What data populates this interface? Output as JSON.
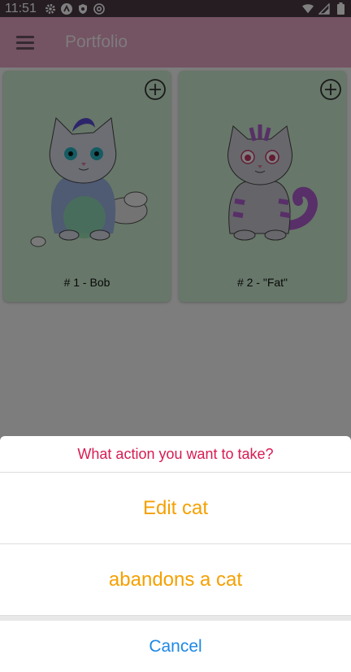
{
  "status_bar": {
    "time": "11:51",
    "left_icons": [
      "gear-icon",
      "vpn-icon",
      "shield-icon",
      "at-icon"
    ],
    "right_icons": [
      "wifi-icon",
      "signal-icon",
      "battery-icon"
    ]
  },
  "app_bar": {
    "title": "Portfolio",
    "menu_icon": "hamburger-menu-icon",
    "color": "#e9a6c5"
  },
  "cards": [
    {
      "label": "# 1 - Bob",
      "action_icon": "add-circle-icon",
      "image": "cat-bob"
    },
    {
      "label": "# 2 - \"Fat\"",
      "action_icon": "add-circle-icon",
      "image": "cat-fat"
    }
  ],
  "action_sheet": {
    "title": "What action you want to take?",
    "options": [
      "Edit cat",
      "abandons a cat"
    ],
    "cancel": "Cancel",
    "colors": {
      "title": "#d81b52",
      "option": "#f5a000",
      "cancel": "#1e88e5"
    }
  }
}
